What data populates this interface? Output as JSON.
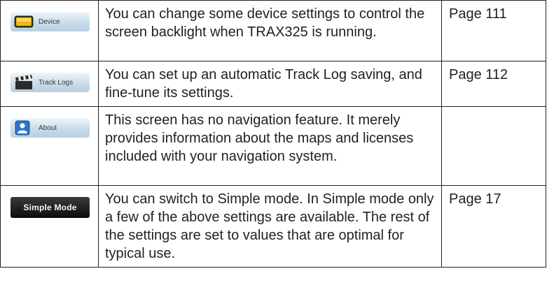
{
  "rows": [
    {
      "button_label": "Device",
      "button_icon": "monitor-icon",
      "description": "You can change some device settings to control the screen backlight when TRAX325 is running.",
      "page": "Page 111"
    },
    {
      "button_label": "Track Logs",
      "button_icon": "clapperboard-icon",
      "description": "You can set up an automatic Track Log saving, and fine-tune its settings.",
      "page": "Page 112"
    },
    {
      "button_label": "About",
      "button_icon": "person-icon",
      "description": "This screen has no navigation feature. It merely provides information about the maps and licenses included with your navigation system.",
      "page": ""
    },
    {
      "button_label": "Simple Mode",
      "button_icon": "",
      "description": "You can switch to Simple mode. In Simple mode only a few of the above settings are available. The rest of the settings are set to values that are optimal for typical use.",
      "page": "Page 17"
    }
  ],
  "colors": {
    "button_gradient_top": "#eef6fb",
    "button_gradient_bottom": "#b7cfe0",
    "simple_button_bg": "#0c0c0c",
    "text": "#231f20"
  }
}
